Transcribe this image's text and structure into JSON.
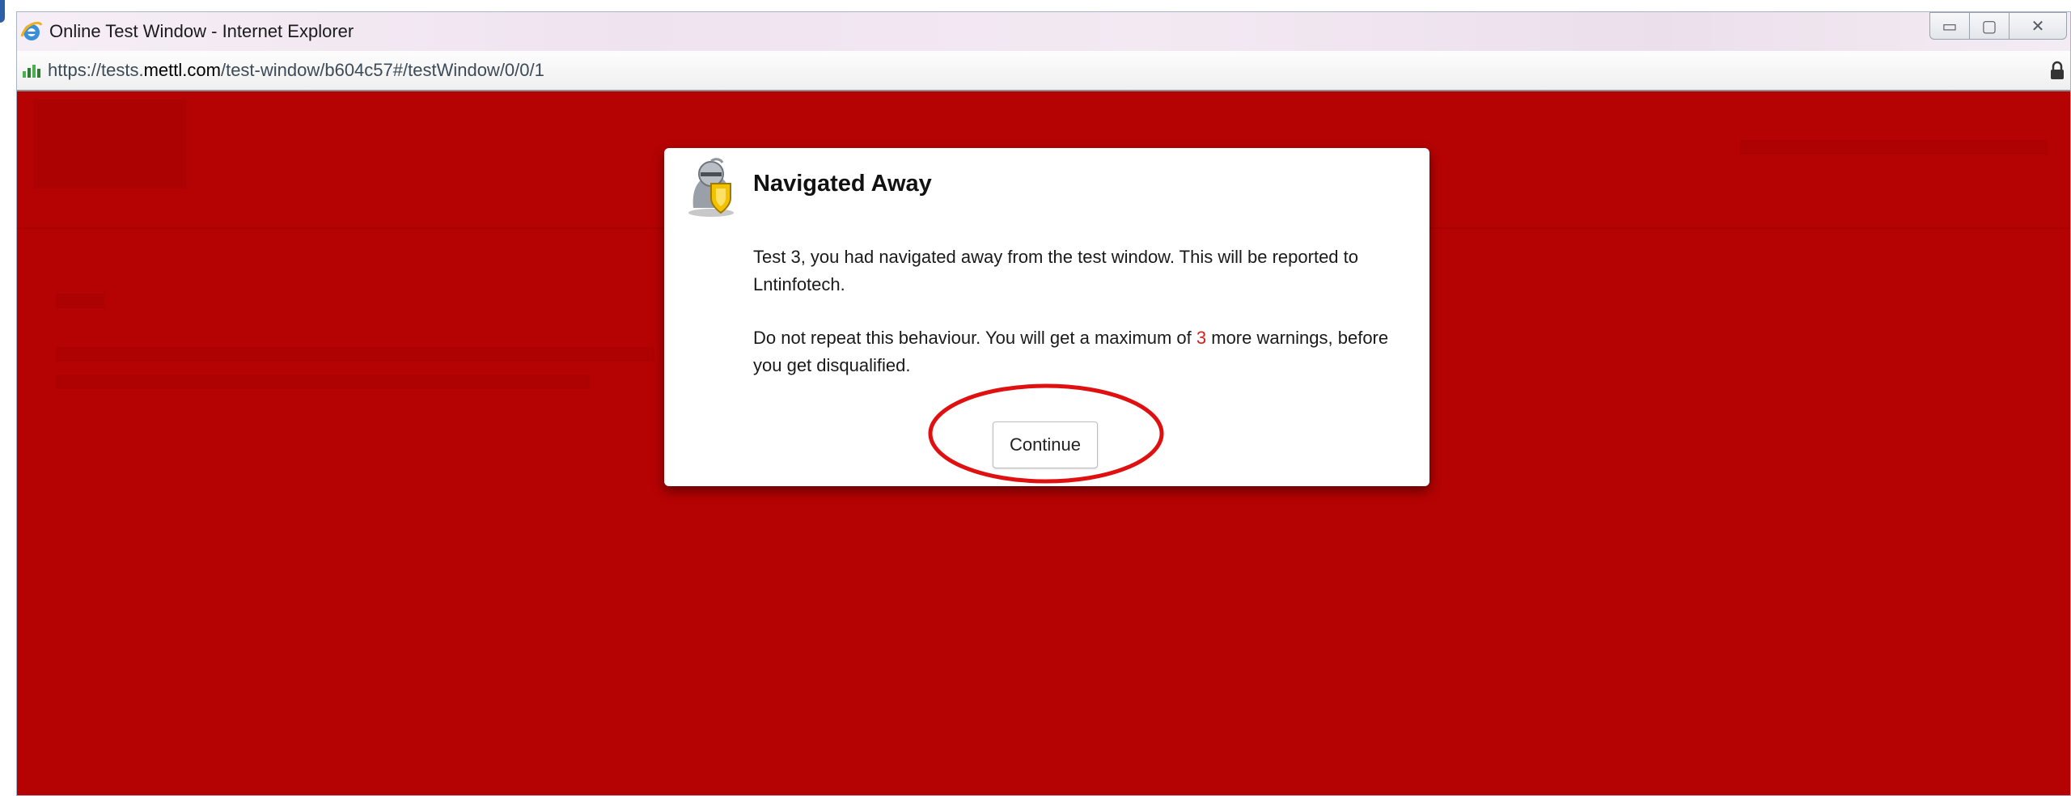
{
  "browser": {
    "window_title": "Online Test Window - Internet Explorer",
    "url_prefix": "https://tests.",
    "url_domain": "mettl.com",
    "url_path": "/test-window/b604c57#/testWindow/0/0/1",
    "icons": {
      "browser_logo": "internet-explorer-icon",
      "site": "mettl-favicon",
      "security": "lock-icon",
      "minimize": "minimize-icon",
      "maximize": "maximize-icon",
      "close": "close-icon"
    },
    "buttons": {
      "minimize": "▭",
      "maximize": "▢",
      "close": "✕"
    }
  },
  "page": {
    "background_color": "#b50303"
  },
  "dialog": {
    "icon": "knight-shield-icon",
    "title": "Navigated Away",
    "message_line1": "Test 3, you had navigated away from the test window. This will be reported to Lntinfotech.",
    "message_line2_prefix": "Do not repeat this behaviour. You will get a maximum of ",
    "remaining_warnings": "3",
    "message_line2_suffix": " more warnings, before you get disqualified.",
    "continue_label": "Continue",
    "warning_color": "#d32020"
  },
  "annotation": {
    "shape": "ellipse",
    "color": "#e01010"
  }
}
